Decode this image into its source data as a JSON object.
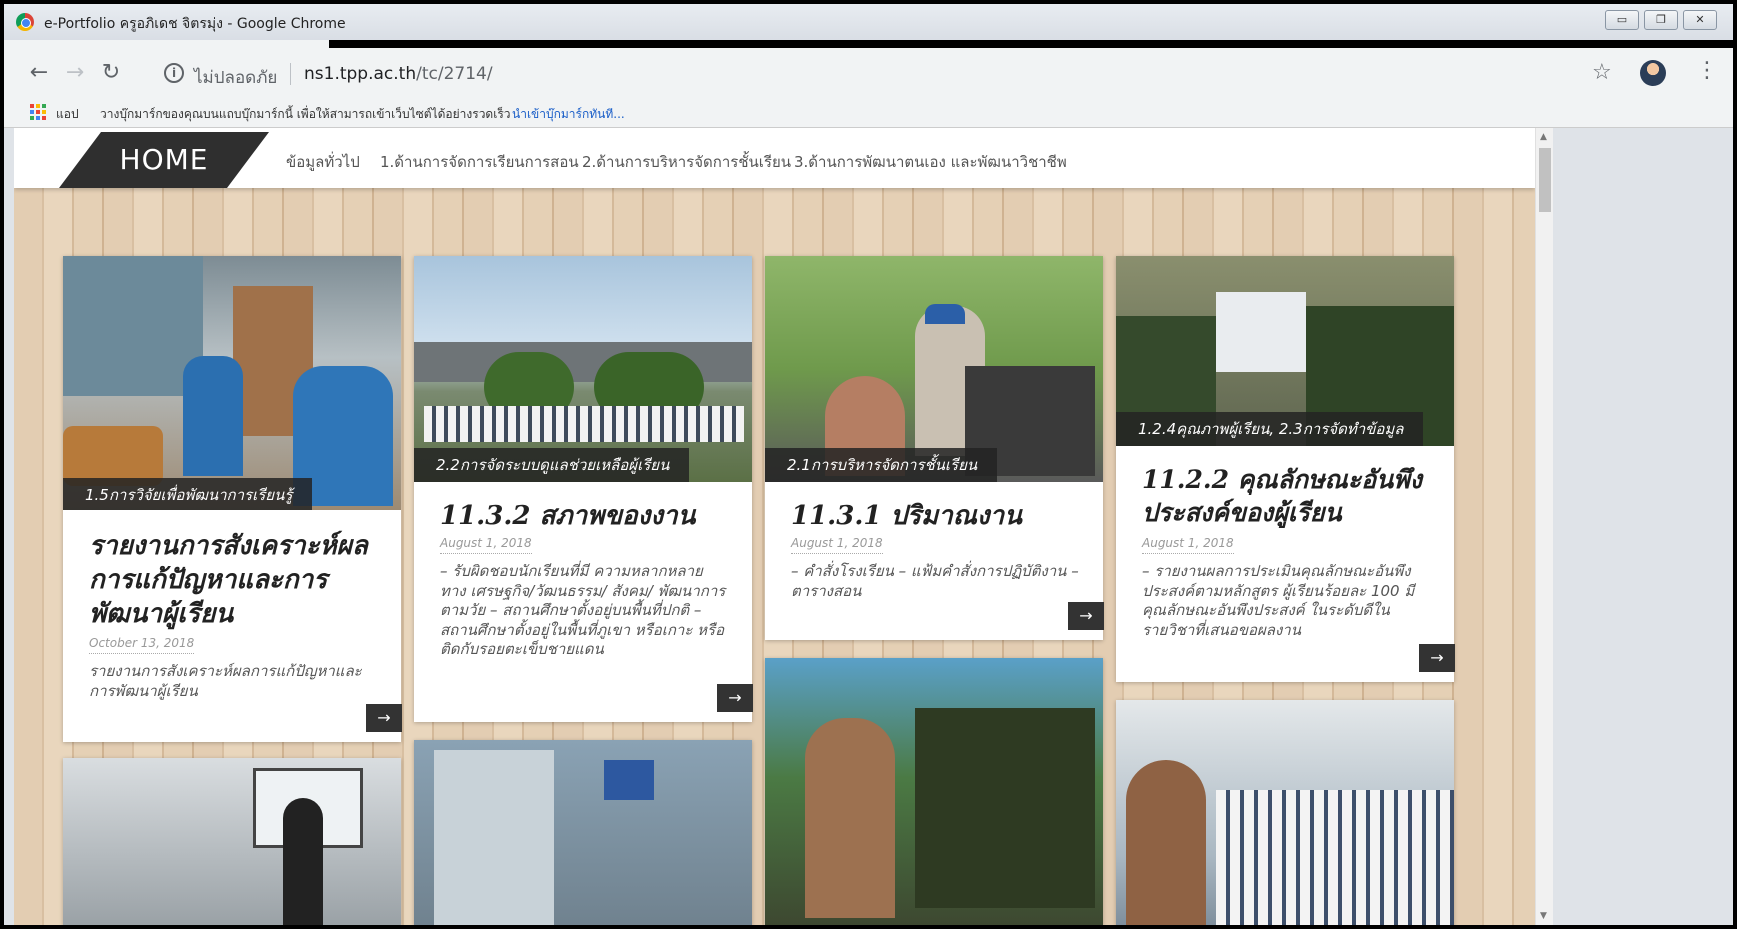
{
  "window": {
    "title": "e-Portfolio ครูอภิเดช จิตรมุ่ง - Google Chrome"
  },
  "toolbar": {
    "security_label": "ไม่ปลอดภัย",
    "url_host": "ns1.tpp.ac.th",
    "url_path": "/tc/2714/"
  },
  "bookmarks": {
    "apps_label": "แอป",
    "hint": "วางบุ๊กมาร์กของคุณบนแถบบุ๊กมาร์กนี้ เพื่อให้สามารถเข้าเว็บไซต์ได้อย่างรวดเร็ว",
    "hint_link": "นำเข้าบุ๊กมาร์กทันที..."
  },
  "site": {
    "home_label": "HOME",
    "nav": [
      "ข้อมูลทั่วไป",
      "1.ด้านการจัดการเรียนการสอน",
      "2.ด้านการบริหารจัดการชั้นเรียน",
      "3.ด้านการพัฒนาตนเอง และพัฒนาวิชาชีพ"
    ]
  },
  "posts": [
    {
      "category": "1.5การวิจัยเพื่อพัฒนาการเรียนรู้",
      "title": "รายงานการสังเคราะห์ผลการแก้ปัญหาและการพัฒนาผู้เรียน",
      "date": "October 13, 2018",
      "excerpt": "รายงานการสังเคราะห์ผลการแก้ปัญหาและการพัฒนาผู้เรียน"
    },
    {
      "category": "2.2การจัดระบบดูแลช่วยเหลือผู้เรียน",
      "title": "11.3.2 สภาพของงาน",
      "date": "August 1, 2018",
      "excerpt": "– รับผิดชอบนักเรียนที่มี ความหลากหลายทาง เศรษฐกิจ/วัฒนธรรม/ สังคม/ พัฒนาการตามวัย – สถานศึกษาตั้งอยู่บนพื้นที่ปกติ – สถานศึกษาตั้งอยู่ในพื้นที่ภูเขา หรือเกาะ หรือติดกับรอยตะเข็บชายแดน"
    },
    {
      "category": "2.1การบริหารจัดการชั้นเรียน",
      "title": "11.3.1 ปริมาณงาน",
      "date": "August 1, 2018",
      "excerpt": "– คำสั่งโรงเรียน – แฟ้มคำสั่งการปฏิบัติงาน – ตารางสอน"
    },
    {
      "category": "1.2.4คุณภาพผู้เรียน, 2.3การจัดทำข้อมูล",
      "title": "11.2.2 คุณลักษณะอันพึงประสงค์ของผู้เรียน",
      "date": "August 1, 2018",
      "excerpt": "– รายงานผลการประเมินคุณลักษณะอันพึงประสงค์ตามหลักสูตร ผู้เรียนร้อยละ 100 มีคุณลักษณะอันพึงประสงค์ ในระดับดีในรายวิชาที่เสนอขอผลงาน"
    }
  ],
  "arrow_glyph": "→",
  "colors": {
    "nav_dark": "#2f2f2f",
    "caption_bg": "#232323",
    "link_blue": "#1a5ec8"
  }
}
